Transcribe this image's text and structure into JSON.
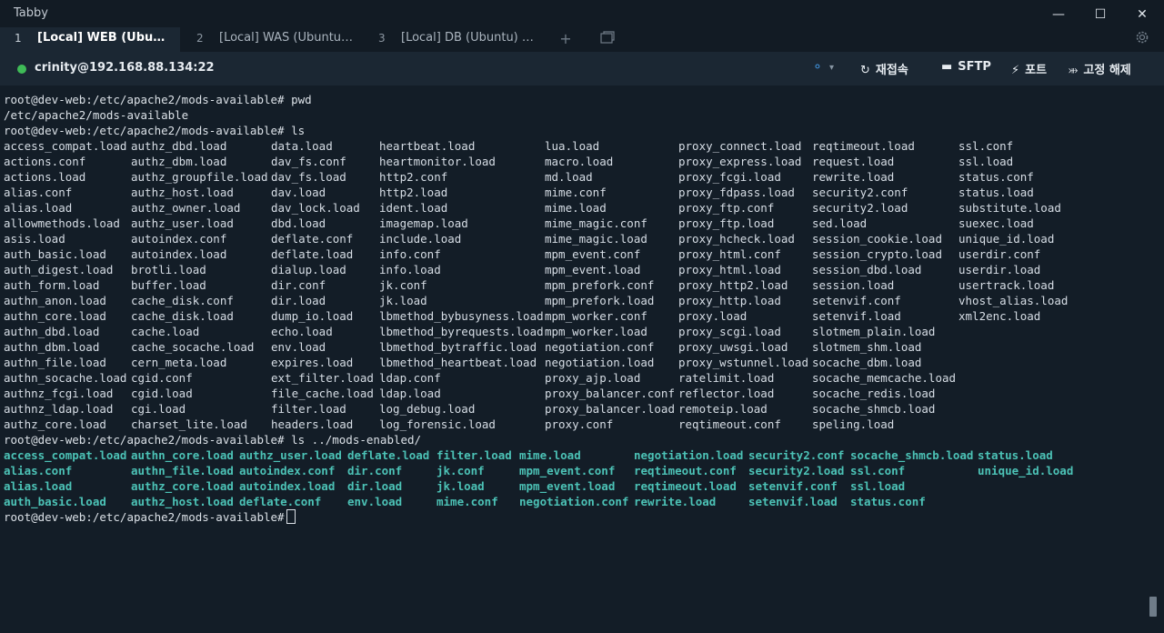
{
  "window": {
    "title": "Tabby",
    "controls": [
      "minimize",
      "maximize",
      "close"
    ]
  },
  "tabs": [
    {
      "number": "1",
      "label": "[Local] WEB (Ubuntu) ...",
      "active": true
    },
    {
      "number": "2",
      "label": "[Local] WAS (Ubuntu) ..."
    },
    {
      "number": "3",
      "label": "[Local] DB (Ubuntu) G..."
    }
  ],
  "tab_actions": {
    "new_tab": "+",
    "layout_icon": "window-layout-icon",
    "settings_icon": "gear-icon"
  },
  "session": {
    "host": "crinity@192.168.88.134:22",
    "status_color": "#3fbb57",
    "buttons": {
      "reconnect": "재접속",
      "sftp": "SFTP",
      "ports": "포트",
      "unpin": "고정 해제"
    }
  },
  "colors": {
    "background": "#131d27",
    "bar": "#1b2733",
    "highlight": "#4cc2b6",
    "accent": "#3f8fd6"
  },
  "terminal": {
    "prompt": "root@dev-web:/etc/apache2/mods-available#",
    "cmd1": " pwd",
    "pwd_output": "/etc/apache2/mods-available",
    "cmd2": " ls",
    "cmd3": " ls ../mods-enabled/",
    "available": [
      [
        "access_compat.load",
        "authz_dbd.load",
        "data.load",
        "heartbeat.load",
        "lua.load",
        "proxy_connect.load",
        "reqtimeout.load",
        "ssl.conf"
      ],
      [
        "actions.conf",
        "authz_dbm.load",
        "dav_fs.conf",
        "heartmonitor.load",
        "macro.load",
        "proxy_express.load",
        "request.load",
        "ssl.load"
      ],
      [
        "actions.load",
        "authz_groupfile.load",
        "dav_fs.load",
        "http2.conf",
        "md.load",
        "proxy_fcgi.load",
        "rewrite.load",
        "status.conf"
      ],
      [
        "alias.conf",
        "authz_host.load",
        "dav.load",
        "http2.load",
        "mime.conf",
        "proxy_fdpass.load",
        "security2.conf",
        "status.load"
      ],
      [
        "alias.load",
        "authz_owner.load",
        "dav_lock.load",
        "ident.load",
        "mime.load",
        "proxy_ftp.conf",
        "security2.load",
        "substitute.load"
      ],
      [
        "allowmethods.load",
        "authz_user.load",
        "dbd.load",
        "imagemap.load",
        "mime_magic.conf",
        "proxy_ftp.load",
        "sed.load",
        "suexec.load"
      ],
      [
        "asis.load",
        "autoindex.conf",
        "deflate.conf",
        "include.load",
        "mime_magic.load",
        "proxy_hcheck.load",
        "session_cookie.load",
        "unique_id.load"
      ],
      [
        "auth_basic.load",
        "autoindex.load",
        "deflate.load",
        "info.conf",
        "mpm_event.conf",
        "proxy_html.conf",
        "session_crypto.load",
        "userdir.conf"
      ],
      [
        "auth_digest.load",
        "brotli.load",
        "dialup.load",
        "info.load",
        "mpm_event.load",
        "proxy_html.load",
        "session_dbd.load",
        "userdir.load"
      ],
      [
        "auth_form.load",
        "buffer.load",
        "dir.conf",
        "jk.conf",
        "mpm_prefork.conf",
        "proxy_http2.load",
        "session.load",
        "usertrack.load"
      ],
      [
        "authn_anon.load",
        "cache_disk.conf",
        "dir.load",
        "jk.load",
        "mpm_prefork.load",
        "proxy_http.load",
        "setenvif.conf",
        "vhost_alias.load"
      ],
      [
        "authn_core.load",
        "cache_disk.load",
        "dump_io.load",
        "lbmethod_bybusyness.load",
        "mpm_worker.conf",
        "proxy.load",
        "setenvif.load",
        "xml2enc.load"
      ],
      [
        "authn_dbd.load",
        "cache.load",
        "echo.load",
        "lbmethod_byrequests.load",
        "mpm_worker.load",
        "proxy_scgi.load",
        "slotmem_plain.load",
        ""
      ],
      [
        "authn_dbm.load",
        "cache_socache.load",
        "env.load",
        "lbmethod_bytraffic.load",
        "negotiation.conf",
        "proxy_uwsgi.load",
        "slotmem_shm.load",
        ""
      ],
      [
        "authn_file.load",
        "cern_meta.load",
        "expires.load",
        "lbmethod_heartbeat.load",
        "negotiation.load",
        "proxy_wstunnel.load",
        "socache_dbm.load",
        ""
      ],
      [
        "authn_socache.load",
        "cgid.conf",
        "ext_filter.load",
        "ldap.conf",
        "proxy_ajp.load",
        "ratelimit.load",
        "socache_memcache.load",
        ""
      ],
      [
        "authnz_fcgi.load",
        "cgid.load",
        "file_cache.load",
        "ldap.load",
        "proxy_balancer.conf",
        "reflector.load",
        "socache_redis.load",
        ""
      ],
      [
        "authnz_ldap.load",
        "cgi.load",
        "filter.load",
        "log_debug.load",
        "proxy_balancer.load",
        "remoteip.load",
        "socache_shmcb.load",
        ""
      ],
      [
        "authz_core.load",
        "charset_lite.load",
        "headers.load",
        "log_forensic.load",
        "proxy.conf",
        "reqtimeout.conf",
        "speling.load",
        ""
      ]
    ],
    "enabled": [
      [
        "access_compat.load",
        "authn_core.load",
        "authz_user.load",
        "deflate.load",
        "filter.load",
        "mime.load",
        "negotiation.load",
        "security2.conf",
        "socache_shmcb.load",
        "status.load"
      ],
      [
        "alias.conf",
        "authn_file.load",
        "autoindex.conf",
        "dir.conf",
        "jk.conf",
        "mpm_event.conf",
        "reqtimeout.conf",
        "security2.load",
        "ssl.conf",
        "unique_id.load"
      ],
      [
        "alias.load",
        "authz_core.load",
        "autoindex.load",
        "dir.load",
        "jk.load",
        "mpm_event.load",
        "reqtimeout.load",
        "setenvif.conf",
        "ssl.load",
        ""
      ],
      [
        "auth_basic.load",
        "authz_host.load",
        "deflate.conf",
        "env.load",
        "mime.conf",
        "negotiation.conf",
        "rewrite.load",
        "setenvif.load",
        "status.conf",
        ""
      ]
    ]
  }
}
